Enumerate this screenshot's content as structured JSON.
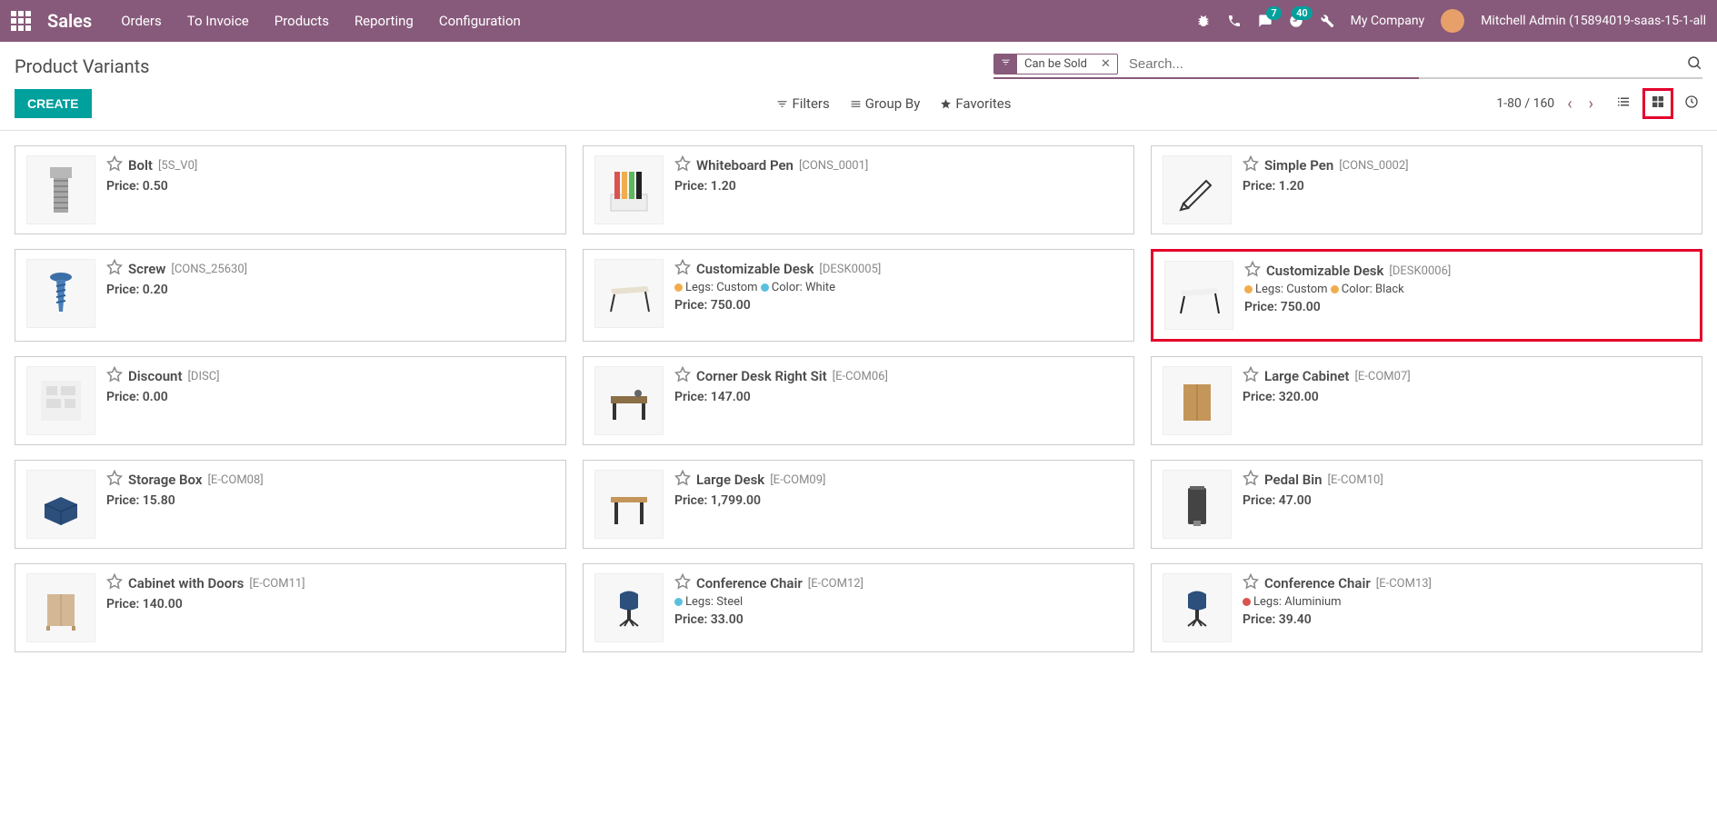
{
  "nav": {
    "brand": "Sales",
    "menu": [
      "Orders",
      "To Invoice",
      "Products",
      "Reporting",
      "Configuration"
    ],
    "chat_badge": "7",
    "clock_badge": "40",
    "company": "My Company",
    "user": "Mitchell Admin (15894019-saas-15-1-all"
  },
  "cp": {
    "title": "Product Variants",
    "filter_chip": "Can be Sold",
    "search_placeholder": "Search...",
    "create": "CREATE",
    "filters": "Filters",
    "groupby": "Group By",
    "favorites": "Favorites",
    "pager": "1-80 / 160"
  },
  "products": [
    {
      "name": "Bolt",
      "sku": "[5S_V0]",
      "price": "Price: 0.50",
      "attrs": [],
      "img": "bolt"
    },
    {
      "name": "Whiteboard Pen",
      "sku": "[CONS_0001]",
      "price": "Price: 1.20",
      "attrs": [],
      "img": "markers"
    },
    {
      "name": "Simple Pen",
      "sku": "[CONS_0002]",
      "price": "Price: 1.20",
      "attrs": [],
      "img": "pen"
    },
    {
      "name": "Screw",
      "sku": "[CONS_25630]",
      "price": "Price: 0.20",
      "attrs": [],
      "img": "screw"
    },
    {
      "name": "Customizable Desk",
      "sku": "[DESK0005]",
      "price": "Price: 750.00",
      "attrs": [
        {
          "c": "#f0ad4e",
          "t": "Legs: Custom"
        },
        {
          "c": "#5bc0de",
          "t": "Color: White"
        }
      ],
      "img": "desk1"
    },
    {
      "name": "Customizable Desk",
      "sku": "[DESK0006]",
      "price": "Price: 750.00",
      "attrs": [
        {
          "c": "#f0ad4e",
          "t": "Legs: Custom"
        },
        {
          "c": "#f0ad4e",
          "t": "Color: Black"
        }
      ],
      "img": "desk2",
      "highlight": true
    },
    {
      "name": "Discount",
      "sku": "[DISC]",
      "price": "Price: 0.00",
      "attrs": [],
      "img": "placeholder"
    },
    {
      "name": "Corner Desk Right Sit",
      "sku": "[E-COM06]",
      "price": "Price: 147.00",
      "attrs": [],
      "img": "corner"
    },
    {
      "name": "Large Cabinet",
      "sku": "[E-COM07]",
      "price": "Price: 320.00",
      "attrs": [],
      "img": "cabinet"
    },
    {
      "name": "Storage Box",
      "sku": "[E-COM08]",
      "price": "Price: 15.80",
      "attrs": [],
      "img": "box"
    },
    {
      "name": "Large Desk",
      "sku": "[E-COM09]",
      "price": "Price: 1,799.00",
      "attrs": [],
      "img": "largedesk"
    },
    {
      "name": "Pedal Bin",
      "sku": "[E-COM10]",
      "price": "Price: 47.00",
      "attrs": [],
      "img": "bin"
    },
    {
      "name": "Cabinet with Doors",
      "sku": "[E-COM11]",
      "price": "Price: 140.00",
      "attrs": [],
      "img": "cabinet2"
    },
    {
      "name": "Conference Chair",
      "sku": "[E-COM12]",
      "price": "Price: 33.00",
      "attrs": [
        {
          "c": "#5bc0de",
          "t": "Legs: Steel"
        }
      ],
      "img": "chair"
    },
    {
      "name": "Conference Chair",
      "sku": "[E-COM13]",
      "price": "Price: 39.40",
      "attrs": [
        {
          "c": "#d9534f",
          "t": "Legs: Aluminium"
        }
      ],
      "img": "chair"
    }
  ]
}
